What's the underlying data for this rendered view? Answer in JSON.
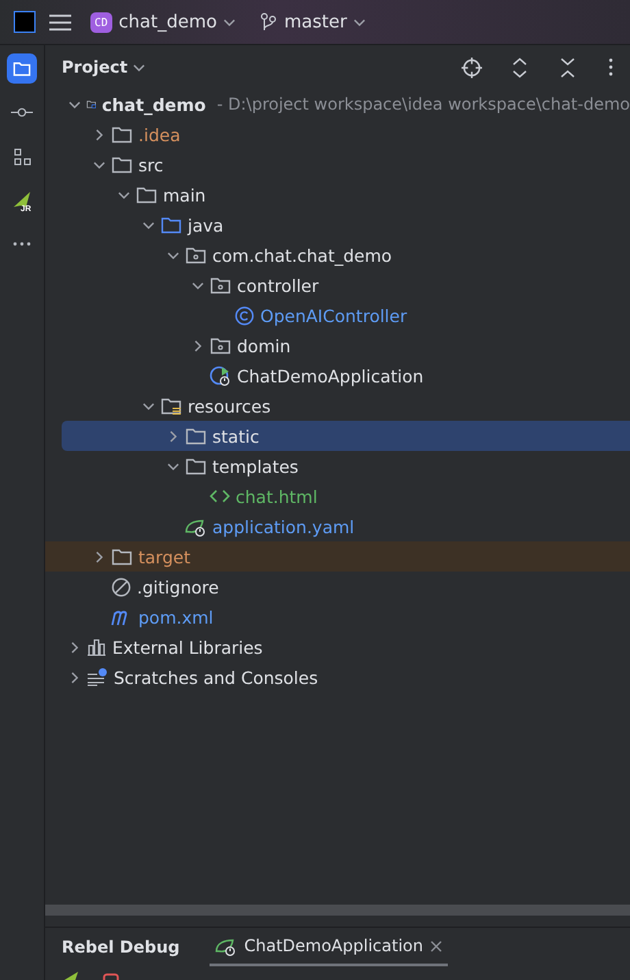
{
  "title_bar": {
    "project_badge": "CD",
    "project": "chat_demo",
    "branch": "master"
  },
  "side_strip": [
    {
      "kind": "project",
      "selected": true
    },
    {
      "kind": "commit",
      "selected": false
    },
    {
      "kind": "structure",
      "selected": false
    },
    {
      "kind": "jrebel",
      "selected": false,
      "badge": "JR"
    },
    {
      "kind": "more",
      "selected": false
    }
  ],
  "panel": {
    "title": "Project"
  },
  "tree": [
    {
      "kind": "module",
      "label": "chat_demo",
      "path": "- D:\\project workspace\\idea workspace\\chat-demo",
      "expanded": true,
      "selected": false,
      "excluded": false,
      "children": [
        {
          "kind": "folder",
          "label": ".idea",
          "expanded": false,
          "selected": false,
          "excluded": true,
          "highlighted": false
        },
        {
          "kind": "folder",
          "label": "src",
          "expanded": true,
          "selected": false,
          "excluded": false,
          "highlighted": false,
          "children": [
            {
              "kind": "folder",
              "label": "main",
              "expanded": true,
              "selected": false,
              "excluded": false,
              "children": [
                {
                  "kind": "source",
                  "label": "java",
                  "expanded": true,
                  "selected": false,
                  "excluded": false,
                  "children": [
                    {
                      "kind": "package",
                      "label": "com.chat.chat_demo",
                      "expanded": true,
                      "selected": false,
                      "excluded": false,
                      "children": [
                        {
                          "kind": "package",
                          "label": "controller",
                          "expanded": true,
                          "selected": false,
                          "excluded": false,
                          "children": [
                            {
                              "kind": "class",
                              "label": "OpenAIController",
                              "selected": false,
                              "excluded": false
                            }
                          ]
                        },
                        {
                          "kind": "package",
                          "label": "domin",
                          "expanded": false,
                          "selected": false,
                          "excluded": false
                        },
                        {
                          "kind": "spring",
                          "label": "ChatDemoApplication",
                          "selected": false,
                          "excluded": false
                        }
                      ]
                    }
                  ]
                },
                {
                  "kind": "resources",
                  "label": "resources",
                  "expanded": true,
                  "selected": false,
                  "excluded": false,
                  "children": [
                    {
                      "kind": "folder",
                      "label": "static",
                      "expanded": false,
                      "selected": true,
                      "excluded": false
                    },
                    {
                      "kind": "folder",
                      "label": "templates",
                      "expanded": true,
                      "selected": false,
                      "excluded": false,
                      "children": [
                        {
                          "kind": "html",
                          "label": "chat.html",
                          "selected": false,
                          "excluded": false
                        }
                      ]
                    },
                    {
                      "kind": "yaml",
                      "label": "application.yaml",
                      "selected": false,
                      "excluded": false
                    }
                  ]
                }
              ]
            }
          ]
        },
        {
          "kind": "folder",
          "label": "target",
          "expanded": false,
          "selected": false,
          "excluded": true,
          "highlighted": true
        },
        {
          "kind": "ignore",
          "label": ".gitignore",
          "selected": false,
          "excluded": false,
          "highlighted": false
        },
        {
          "kind": "maven",
          "label": "pom.xml",
          "selected": false,
          "excluded": false,
          "highlighted": false
        }
      ]
    },
    {
      "kind": "libraries",
      "label": "External Libraries",
      "expanded": false,
      "selected": false,
      "excluded": false
    },
    {
      "kind": "scratches",
      "label": "Scratches and Consoles",
      "expanded": false,
      "selected": false,
      "excluded": false
    }
  ],
  "bottom_panel": {
    "title": "Rebel Debug",
    "tabs": [
      {
        "label": "ChatDemoApplication",
        "selected": true
      }
    ]
  }
}
